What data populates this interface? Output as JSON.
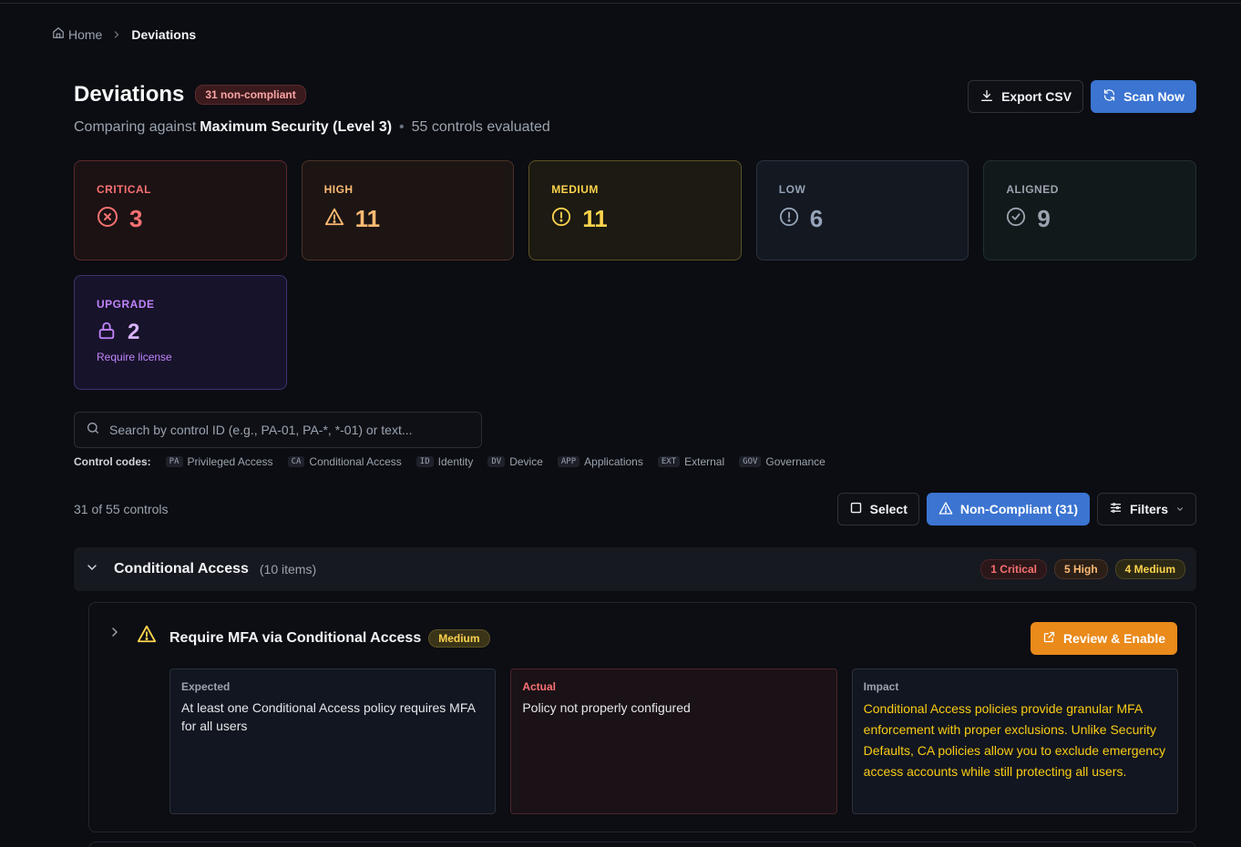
{
  "breadcrumb": {
    "home": "Home",
    "current": "Deviations"
  },
  "header": {
    "title": "Deviations",
    "badge": "31 non-compliant",
    "subtitle_prefix": "Comparing against",
    "baseline": "Maximum Security (Level 3)",
    "evaluated": "55 controls evaluated",
    "export_label": "Export CSV",
    "scan_label": "Scan Now"
  },
  "stats": {
    "critical": {
      "label": "CRITICAL",
      "value": "3"
    },
    "high": {
      "label": "HIGH",
      "value": "11"
    },
    "medium": {
      "label": "MEDIUM",
      "value": "11"
    },
    "low": {
      "label": "LOW",
      "value": "6"
    },
    "aligned": {
      "label": "ALIGNED",
      "value": "9"
    },
    "upgrade": {
      "label": "UPGRADE",
      "value": "2",
      "sub": "Require license"
    }
  },
  "search": {
    "placeholder": "Search by control ID (e.g., PA-01, PA-*, *-01) or text...",
    "value": ""
  },
  "codes": {
    "label": "Control codes:",
    "items": [
      {
        "code": "PA",
        "name": "Privileged Access"
      },
      {
        "code": "CA",
        "name": "Conditional Access"
      },
      {
        "code": "ID",
        "name": "Identity"
      },
      {
        "code": "DV",
        "name": "Device"
      },
      {
        "code": "APP",
        "name": "Applications"
      },
      {
        "code": "EXT",
        "name": "External"
      },
      {
        "code": "GOV",
        "name": "Governance"
      }
    ]
  },
  "toolbar": {
    "count": "31 of 55 controls",
    "select_label": "Select",
    "noncompliant_label": "Non-Compliant (31)",
    "filters_label": "Filters"
  },
  "group": {
    "title": "Conditional Access",
    "count": "(10 items)",
    "pills": {
      "critical": "1 Critical",
      "high": "5 High",
      "medium": "4 Medium"
    }
  },
  "item": {
    "title": "Require MFA via Conditional Access",
    "severity": "Medium",
    "action_label": "Review & Enable",
    "expected_label": "Expected",
    "expected": "At least one Conditional Access policy requires MFA for all users",
    "actual_label": "Actual",
    "actual": "Policy not properly configured",
    "impact_label": "Impact",
    "impact": "Conditional Access policies provide granular MFA enforcement with proper exclusions. Unlike Security Defaults, CA policies allow you to exclude emergency access accounts while still protecting all users."
  },
  "colors": {
    "background": "#0b0d12",
    "primary": "#3b74d1",
    "critical": "#f87171",
    "high": "#fdba74",
    "medium": "#fcd34d",
    "upgrade": "#c084fc",
    "action": "#e98a1b"
  }
}
